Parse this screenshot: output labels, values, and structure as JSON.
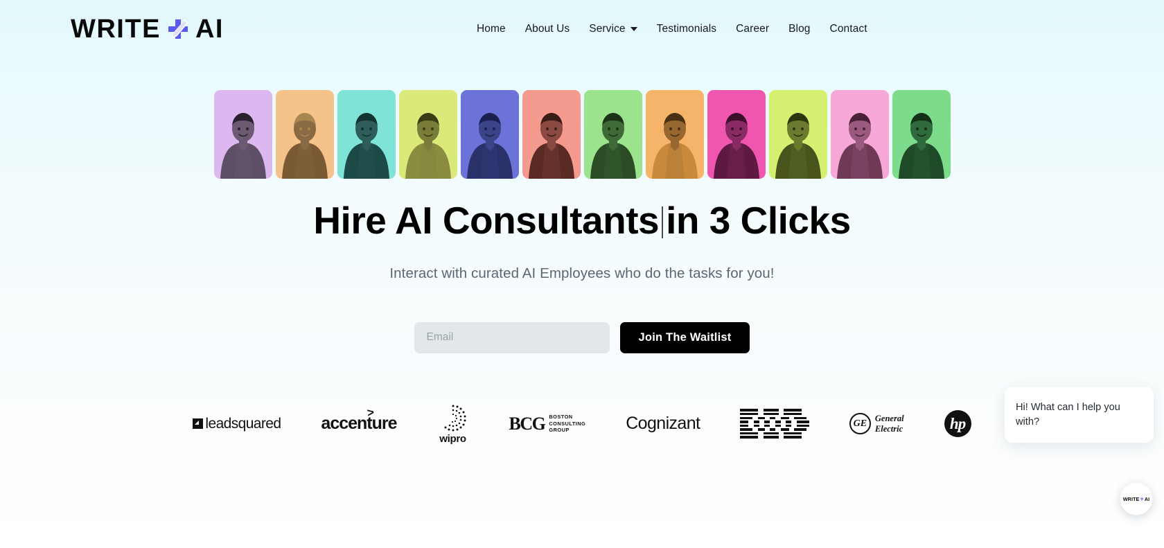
{
  "brand": {
    "name_left": "WRITE",
    "name_right": "AI",
    "mark": "plus-pen-icon",
    "accent": "#5b5bf0"
  },
  "nav": {
    "items": [
      {
        "label": "Home",
        "has_dropdown": false
      },
      {
        "label": "About Us",
        "has_dropdown": false
      },
      {
        "label": "Service",
        "has_dropdown": true
      },
      {
        "label": "Testimonials",
        "has_dropdown": false
      },
      {
        "label": "Career",
        "has_dropdown": false
      },
      {
        "label": "Blog",
        "has_dropdown": false
      },
      {
        "label": "Contact",
        "has_dropdown": false
      }
    ]
  },
  "avatars": [
    {
      "bg": "#ddb8f0",
      "skin": "#6b5a72",
      "hair": "#2a2230",
      "suit": "#5c4f66"
    },
    {
      "bg": "#f5c28a",
      "skin": "#8a6a45",
      "hair": "#a8864f",
      "suit": "#7a5a35"
    },
    {
      "bg": "#7fe3d8",
      "skin": "#2f5d5a",
      "hair": "#123330",
      "suit": "#1c4a46"
    },
    {
      "bg": "#dbe97a",
      "skin": "#7a7d3a",
      "hair": "#3a3c15",
      "suit": "#8a8d3f"
    },
    {
      "bg": "#6b73d8",
      "skin": "#3b4486",
      "hair": "#1b2050",
      "suit": "#2a3168"
    },
    {
      "bg": "#f59a8e",
      "skin": "#8a4a42",
      "hair": "#3a1c18",
      "suit": "#5a2a24"
    },
    {
      "bg": "#9be38c",
      "skin": "#3f6a38",
      "hair": "#1c3317",
      "suit": "#2b4c25"
    },
    {
      "bg": "#f6b46a",
      "skin": "#96672f",
      "hair": "#4a3014",
      "suit": "#c98a3c"
    },
    {
      "bg": "#f055b0",
      "skin": "#8a2a64",
      "hair": "#3d0f2b",
      "suit": "#5c1a42"
    },
    {
      "bg": "#d5ef70",
      "skin": "#6b7a2e",
      "hair": "#2c3610",
      "suit": "#49541c"
    },
    {
      "bg": "#f7a8d8",
      "skin": "#9a5a80",
      "hair": "#4a2238",
      "suit": "#6e3a56"
    },
    {
      "bg": "#7ddb8c",
      "skin": "#2f6a3c",
      "hair": "#143018",
      "suit": "#1f4a28"
    }
  ],
  "hero": {
    "headline_part1": "Hire AI Consultants",
    "headline_part2": "in 3 Clicks",
    "typing_caret": true,
    "subheadline": "Interact with curated AI Employees who do the tasks for you!"
  },
  "waitlist_form": {
    "email_value": "",
    "email_placeholder": "Email",
    "submit_label": "Join The Waitlist"
  },
  "clients": {
    "logos": [
      {
        "id": "leadsquared",
        "text": "leadsquared"
      },
      {
        "id": "accenture",
        "text": "accenture",
        "mark": "greater-than-arrow"
      },
      {
        "id": "wipro",
        "text": "wipro"
      },
      {
        "id": "bcg",
        "text": "BCG",
        "sub_line1": "BOSTON",
        "sub_line2": "CONSULTING",
        "sub_line3": "GROUP"
      },
      {
        "id": "cognizant",
        "text": "Cognizant"
      },
      {
        "id": "ibm",
        "text": "IBM"
      },
      {
        "id": "general-electric",
        "text": "General Electric",
        "monogram": "GE",
        "line1": "General",
        "line2": "Electric"
      },
      {
        "id": "hp",
        "text": "hp"
      }
    ]
  },
  "chat": {
    "message": "Hi! What can I help you with?",
    "launcher_left": "WRITE",
    "launcher_plus": "+",
    "launcher_right": "AI"
  }
}
